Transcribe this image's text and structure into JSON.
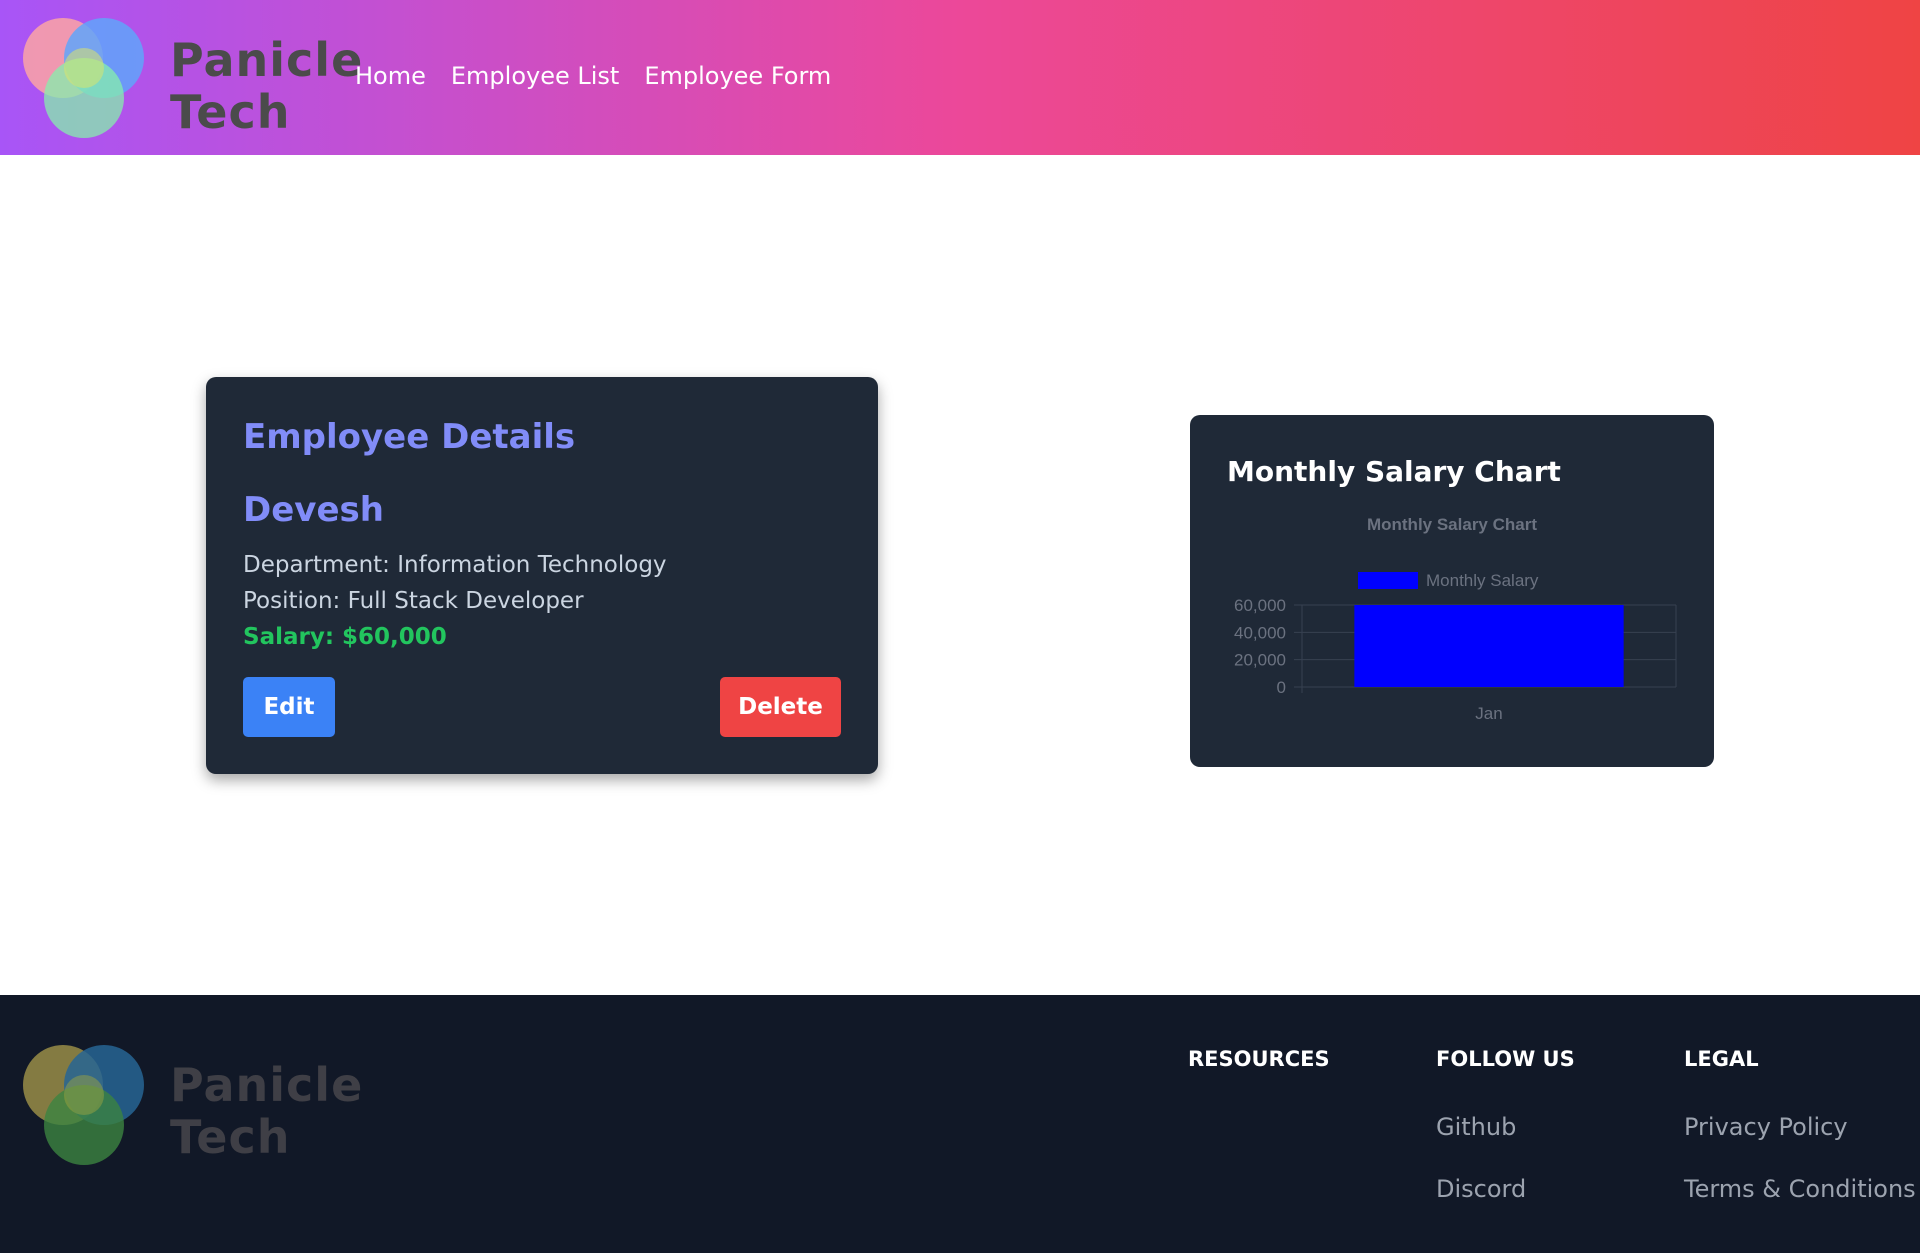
{
  "brand": {
    "line1": "Panicle",
    "line2": "Tech"
  },
  "nav": {
    "items": [
      "Home",
      "Employee List",
      "Employee Form"
    ]
  },
  "employee_card": {
    "title": "Employee Details",
    "name": "Devesh",
    "department": "Department: Information Technology",
    "position": "Position: Full Stack Developer",
    "salary": "Salary: $60,000",
    "edit_label": "Edit",
    "delete_label": "Delete"
  },
  "chart_card": {
    "title": "Monthly Salary Chart"
  },
  "chart_data": {
    "type": "bar",
    "title": "Monthly Salary Chart",
    "categories": [
      "Jan"
    ],
    "series": [
      {
        "name": "Monthly Salary",
        "values": [
          60000
        ],
        "color": "#0000ff"
      }
    ],
    "yticks": [
      "60,000",
      "40,000",
      "20,000",
      "0"
    ],
    "ylim": [
      0,
      60000
    ],
    "grid": true,
    "legend": "top"
  },
  "footer": {
    "resources_heading": "RESOURCES",
    "follow_heading": "FOLLOW US",
    "follow_links": [
      "Github",
      "Discord"
    ],
    "legal_heading": "LEGAL",
    "legal_links": [
      "Privacy Policy",
      "Terms & Conditions"
    ]
  },
  "colors": {
    "header_gradient": [
      "#a855f7",
      "#ec4899",
      "#ef4444"
    ],
    "card_bg": "#1f2937",
    "accent": "#818cf8",
    "salary": "#22c55e",
    "edit": "#3b82f6",
    "delete": "#ef4444",
    "footer_bg": "#111827"
  }
}
